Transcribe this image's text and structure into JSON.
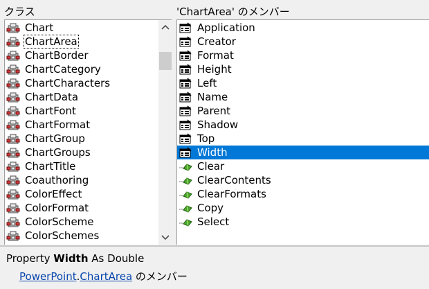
{
  "classes_header": "クラス",
  "members_header": "'ChartArea' のメンバー",
  "classes": [
    {
      "name": "Chart"
    },
    {
      "name": "ChartArea",
      "selected": true
    },
    {
      "name": "ChartBorder"
    },
    {
      "name": "ChartCategory"
    },
    {
      "name": "ChartCharacters"
    },
    {
      "name": "ChartData"
    },
    {
      "name": "ChartFont"
    },
    {
      "name": "ChartFormat"
    },
    {
      "name": "ChartGroup"
    },
    {
      "name": "ChartGroups"
    },
    {
      "name": "ChartTitle"
    },
    {
      "name": "Coauthoring"
    },
    {
      "name": "ColorEffect"
    },
    {
      "name": "ColorFormat"
    },
    {
      "name": "ColorScheme"
    },
    {
      "name": "ColorSchemes"
    }
  ],
  "members": [
    {
      "name": "Application",
      "kind": "property"
    },
    {
      "name": "Creator",
      "kind": "property"
    },
    {
      "name": "Format",
      "kind": "property"
    },
    {
      "name": "Height",
      "kind": "property"
    },
    {
      "name": "Left",
      "kind": "property"
    },
    {
      "name": "Name",
      "kind": "property"
    },
    {
      "name": "Parent",
      "kind": "property"
    },
    {
      "name": "Shadow",
      "kind": "property"
    },
    {
      "name": "Top",
      "kind": "property"
    },
    {
      "name": "Width",
      "kind": "property",
      "selected": true
    },
    {
      "name": "Clear",
      "kind": "method"
    },
    {
      "name": "ClearContents",
      "kind": "method"
    },
    {
      "name": "ClearFormats",
      "kind": "method"
    },
    {
      "name": "Copy",
      "kind": "method"
    },
    {
      "name": "Select",
      "kind": "method"
    }
  ],
  "details": {
    "prefix": "Property ",
    "member": "Width",
    "suffix": " As Double",
    "library": "PowerPoint",
    "dot": ".",
    "class": "ChartArea",
    "member_of": " のメンバー"
  },
  "colors": {
    "selection": "#0078d7",
    "link": "#0645ad"
  }
}
